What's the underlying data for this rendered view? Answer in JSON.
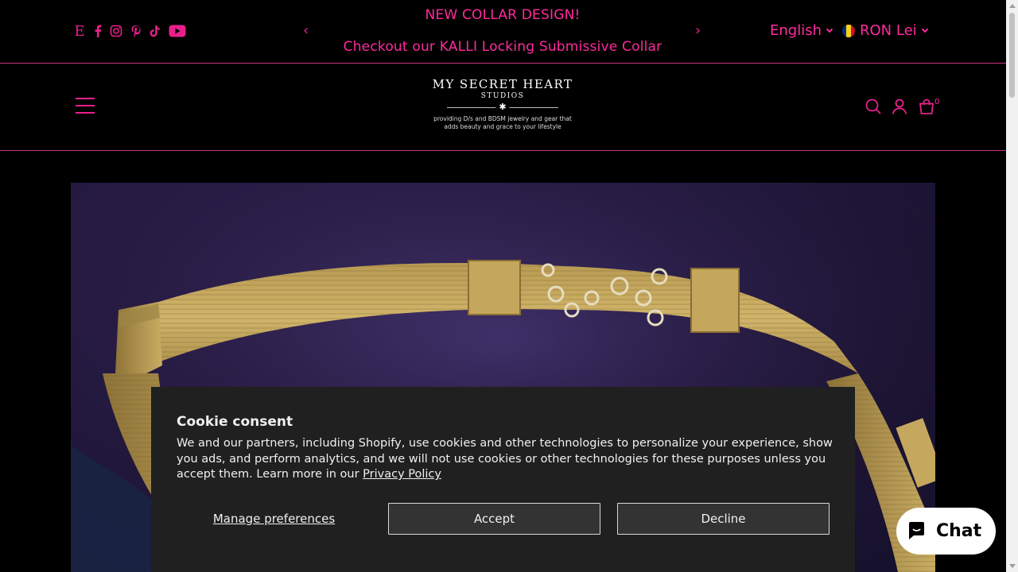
{
  "announcement": {
    "messages": [
      "NEW COLLAR DESIGN!",
      "Checkout our KALLI Locking Submissive Collar"
    ],
    "prev_arrow": "‹",
    "next_arrow": "›",
    "accent_color": "#ff2b9e"
  },
  "socials": [
    {
      "icon": "etsy-icon",
      "glyph": "E"
    },
    {
      "icon": "facebook-icon"
    },
    {
      "icon": "instagram-icon"
    },
    {
      "icon": "pinterest-icon"
    },
    {
      "icon": "tiktok-icon"
    },
    {
      "icon": "youtube-icon"
    }
  ],
  "selectors": {
    "language": "English",
    "currency": "RON Lei",
    "currency_flag": "romania-flag-icon"
  },
  "header": {
    "logo_title": "MY SECRET HEART",
    "logo_subtitle": "STUDIOS",
    "logo_star": "✱",
    "logo_tagline_1": "providing D/s and BDSM jewelry and gear that",
    "logo_tagline_2": "adds beauty and grace to your lifestyle",
    "cart_count": "0",
    "icons": [
      "menu-icon",
      "search-icon",
      "account-icon",
      "cart-icon"
    ]
  },
  "cookie": {
    "title": "Cookie consent",
    "body": "We and our partners, including Shopify, use cookies and other technologies to personalize your experience, show you ads, and perform analytics, and we will not use cookies or other technologies for these purposes unless you accept them. Learn more in our ",
    "privacy_link": "Privacy Policy",
    "manage_label": "Manage preferences",
    "accept_label": "Accept",
    "decline_label": "Decline"
  },
  "chat": {
    "label": "Chat",
    "icon": "chat-bubble-icon"
  }
}
